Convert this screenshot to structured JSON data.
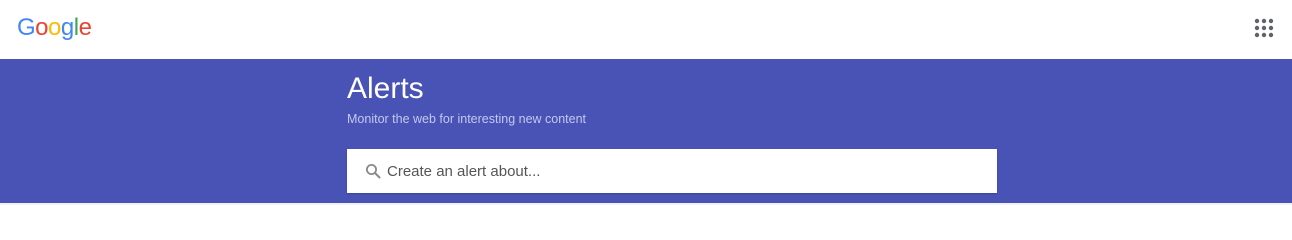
{
  "header": {
    "logo_letters": [
      {
        "char": "G",
        "color": "#4285F4"
      },
      {
        "char": "o",
        "color": "#EA4335"
      },
      {
        "char": "o",
        "color": "#FBBC05"
      },
      {
        "char": "g",
        "color": "#4285F4"
      },
      {
        "char": "l",
        "color": "#34A853"
      },
      {
        "char": "e",
        "color": "#EA4335"
      }
    ],
    "apps_icon": "apps-grid-icon"
  },
  "hero": {
    "title": "Alerts",
    "subtitle": "Monitor the web for interesting new content",
    "background_color": "#4953b5"
  },
  "search": {
    "icon": "search-icon",
    "placeholder": "Create an alert about...",
    "value": ""
  }
}
